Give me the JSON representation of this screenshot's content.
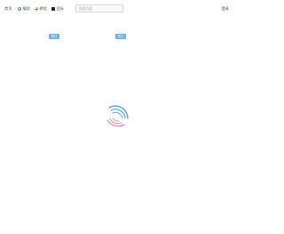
{
  "nav": {
    "home": "首页",
    "items": [
      {
        "label": "编程",
        "icon": "clock-icon"
      },
      {
        "label": "教程",
        "icon": "plus-icon"
      },
      {
        "label": "目标",
        "icon": "tag-icon"
      }
    ]
  },
  "search": {
    "placeholder": "搜索内容"
  },
  "account": {
    "login": "登录"
  },
  "cards": [
    {
      "badge": "热门"
    },
    {
      "badge": "热门"
    }
  ],
  "loading": {
    "icon": "loading-spinner-icon",
    "colors": {
      "blue": "#4a9ee0",
      "pink": "#e890a8"
    }
  },
  "colors": {
    "badge_start": "#7fa6e6",
    "badge_end": "#5fc2d8",
    "accent_orange": "#e07b39",
    "accent_blue": "#4a90c0"
  }
}
